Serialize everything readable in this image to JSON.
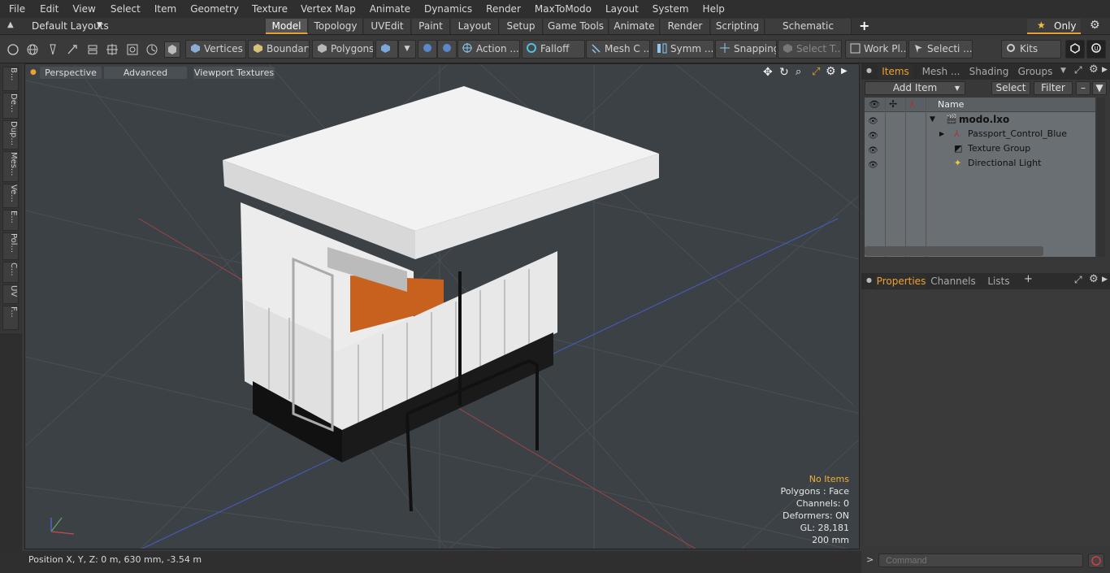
{
  "menu": [
    "File",
    "Edit",
    "View",
    "Select",
    "Item",
    "Geometry",
    "Texture",
    "Vertex Map",
    "Animate",
    "Dynamics",
    "Render",
    "MaxToModo",
    "Layout",
    "System",
    "Help"
  ],
  "layouts": {
    "default_label": "Default Layouts",
    "tabs": [
      "Model",
      "Topology",
      "UVEdit",
      "Paint",
      "Layout",
      "Setup",
      "Game Tools",
      "Animate",
      "Render",
      "Scripting",
      "Schematic Fusion"
    ],
    "active_tab": "Model",
    "plus": "+",
    "only_label": "Only"
  },
  "toolbar": {
    "vertices": "Vertices",
    "boundary": "Boundary",
    "polygons": "Polygons",
    "action": "Action ...",
    "falloff": "Falloff",
    "mesh": "Mesh C ...",
    "symm": "Symm ...",
    "snapping": "Snapping",
    "select_t": "Select T...",
    "workpl": "Work Pl...",
    "selecti": "Selecti ...",
    "kits": "Kits"
  },
  "left_tabs": [
    "B...",
    "De...",
    "Dup...",
    "Mes...",
    "Ve...",
    "E...",
    "Pol...",
    "C...",
    "UV",
    "F..."
  ],
  "viewport": {
    "perspective": "Perspective",
    "advanced": "Advanced",
    "textures": "Viewport Textures",
    "info": {
      "no_items": "No Items",
      "polygons": "Polygons : Face",
      "channels": "Channels: 0",
      "deformers": "Deformers: ON",
      "gl": "GL: 28,181",
      "scale": "200 mm"
    }
  },
  "status": {
    "position": "Position X, Y, Z:   0 m, 630 mm, -3.54 m"
  },
  "right": {
    "tabs": [
      "Items",
      "Mesh ...",
      "Shading",
      "Groups"
    ],
    "active_tab": "Items",
    "add_item": "Add Item",
    "select": "Select",
    "filter": "Filter",
    "name_header": "Name",
    "items": [
      {
        "label": "modo.lxo"
      },
      {
        "label": "Passport_Control_Blue"
      },
      {
        "label": "Texture Group"
      },
      {
        "label": "Directional Light"
      }
    ],
    "prop_tabs": [
      "Properties",
      "Channels",
      "Lists"
    ],
    "active_prop_tab": "Properties",
    "plus": "+",
    "command_placeholder": "Command"
  },
  "colors": {
    "accent": "#f0a030",
    "viewport_bg": "#3c4146"
  }
}
